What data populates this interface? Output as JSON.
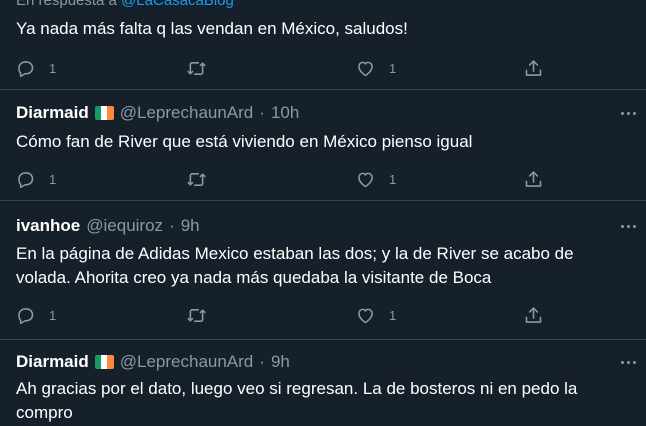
{
  "reply_context": {
    "prefix": "En respuesta a",
    "handle": "@LaCasacaBlog"
  },
  "colors": {
    "background": "#15202b",
    "text": "#ffffff",
    "muted": "#8b98a5",
    "link": "#1d9bf0",
    "separator": "#38444d"
  },
  "icons": {
    "reply": "reply-icon",
    "retweet": "retweet-icon",
    "like": "heart-icon",
    "share": "share-icon",
    "more": "more-icon",
    "flag": "ireland-flag-icon"
  },
  "tweets": [
    {
      "text": "Ya nada más falta q las vendan en México, saludos!",
      "reply_count": "1",
      "like_count": "1"
    },
    {
      "author": "Diarmaid",
      "handle": "@LeprechaunArd",
      "separator": "·",
      "time": "10h",
      "text": "Cómo fan de River que está viviendo en México pienso igual",
      "reply_count": "1",
      "like_count": "1"
    },
    {
      "author": "ivanhoe",
      "handle": "@iequiroz",
      "separator": "·",
      "time": "9h",
      "text": "En la página de Adidas Mexico estaban las dos; y la de River se acabo de volada. Ahorita creo ya nada más quedaba la visitante de Boca",
      "reply_count": "1",
      "like_count": "1"
    },
    {
      "author": "Diarmaid",
      "handle": "@LeprechaunArd",
      "separator": "·",
      "time": "9h",
      "text": "Ah gracias por el dato, luego veo si regresan. La de bosteros ni en pedo la compro"
    }
  ]
}
